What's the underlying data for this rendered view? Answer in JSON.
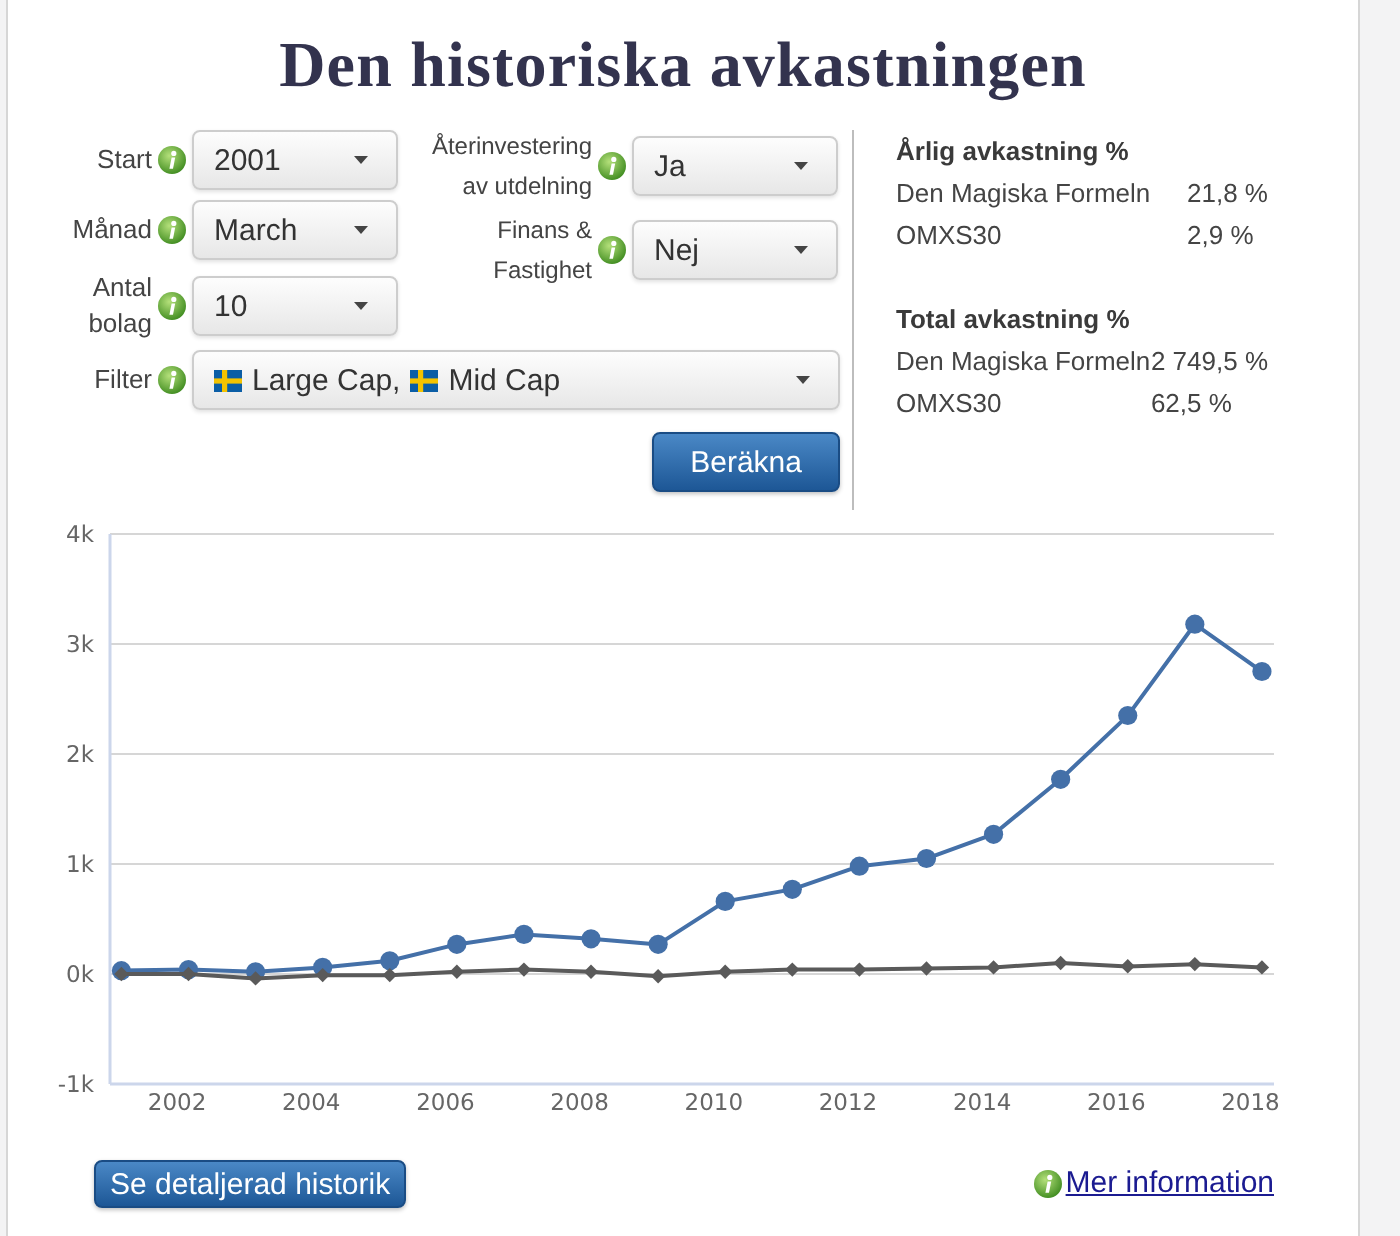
{
  "title": "Den historiska avkastningen",
  "form": {
    "columns": [
      [
        {
          "label": "Start",
          "value": "2001"
        },
        {
          "label": "Månad",
          "value": "March"
        },
        {
          "label": "Antal bolag",
          "value": "10"
        }
      ],
      [
        {
          "label": "Återinvestering av utdelning",
          "value": "Ja"
        },
        {
          "label": "Finans & Fastighet",
          "value": "Nej"
        }
      ]
    ],
    "filter": {
      "label": "Filter",
      "options": [
        "Large Cap,",
        "Mid Cap"
      ]
    },
    "submit_button": "Beräkna"
  },
  "results": [
    {
      "heading": "Årlig avkastning %",
      "rows": [
        {
          "name": "Den Magiska Formeln",
          "value": "21,8 %"
        },
        {
          "name": "OMXS30",
          "value": "2,9 %"
        }
      ]
    },
    {
      "heading": "Total avkastning %",
      "rows": [
        {
          "name": "Den Magiska Formeln",
          "value": "2 749,5 %"
        },
        {
          "name": "OMXS30",
          "value": "62,5 %"
        }
      ]
    }
  ],
  "chart": {
    "chart_data": {
      "type": "line",
      "grid": true,
      "x": [
        2001.17,
        2002.17,
        2003.17,
        2004.17,
        2005.17,
        2006.17,
        2007.17,
        2008.17,
        2009.17,
        2010.17,
        2011.17,
        2012.17,
        2013.17,
        2014.17,
        2015.17,
        2016.17,
        2017.17,
        2018.17
      ],
      "series": [
        {
          "color": "#4470a8",
          "marker": "circle",
          "values": [
            30,
            40,
            20,
            60,
            120,
            270,
            360,
            320,
            270,
            660,
            770,
            980,
            1050,
            1270,
            1770,
            2350,
            3180,
            2750
          ]
        },
        {
          "color": "#5a5a5a",
          "marker": "diamond",
          "values": [
            0,
            0,
            -40,
            -10,
            -10,
            20,
            40,
            20,
            -20,
            20,
            40,
            40,
            50,
            60,
            100,
            70,
            90,
            60
          ]
        }
      ],
      "xlim": [
        2001,
        2018.35
      ],
      "ylim": [
        -1000,
        4000
      ],
      "xticks": [
        2002,
        2004,
        2006,
        2008,
        2010,
        2012,
        2014,
        2016,
        2018
      ],
      "yticks": [
        {
          "value": -1000,
          "label": "-1k"
        },
        {
          "value": 0,
          "label": "0k"
        },
        {
          "value": 1000,
          "label": "1k"
        },
        {
          "value": 2000,
          "label": "2k"
        },
        {
          "value": 3000,
          "label": "3k"
        },
        {
          "value": 4000,
          "label": "4k"
        }
      ]
    }
  },
  "footer": {
    "history_button": "Se detaljerad historik",
    "info_link": "Mer information"
  }
}
